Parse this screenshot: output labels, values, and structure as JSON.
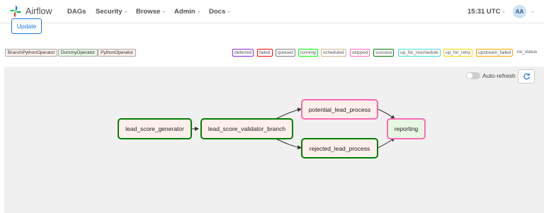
{
  "nav": {
    "brand": "Airflow",
    "items": [
      "DAGs",
      "Security",
      "Browse",
      "Admin",
      "Docs"
    ],
    "time": "15:31 UTC",
    "user_initials": "AA"
  },
  "update_label": "Update",
  "operators": [
    {
      "label": "BranchPythonOperator",
      "color": "#ffefeb"
    },
    {
      "label": "DummyOperator",
      "color": "#e8f7e4"
    },
    {
      "label": "PythonOperator",
      "color": "#ffefeb"
    }
  ],
  "statuses": [
    {
      "label": "deferred",
      "color": "#8a2be2"
    },
    {
      "label": "failed",
      "color": "#ff0000"
    },
    {
      "label": "queued",
      "color": "#808080"
    },
    {
      "label": "running",
      "color": "#00ff00"
    },
    {
      "label": "scheduled",
      "color": "#d2b48c"
    },
    {
      "label": "skipped",
      "color": "#ff69b4"
    },
    {
      "label": "success",
      "color": "#008000"
    },
    {
      "label": "up_for_reschedule",
      "color": "#40e0d0"
    },
    {
      "label": "up_for_retry",
      "color": "#ffd700"
    },
    {
      "label": "upstream_failed",
      "color": "#ffa500"
    },
    {
      "label": "no_status",
      "color": "#ffffff"
    }
  ],
  "graph": {
    "auto_refresh_label": "Auto-refresh",
    "nodes": {
      "lead_score_generator": "lead_score_generator",
      "lead_score_validator_branch": "lead_score_validator_branch",
      "potential_lead_process": "potential_lead_process",
      "rejected_lead_process": "rejected_lead_process",
      "reporting": "reporting"
    }
  },
  "colors": {
    "success_border": "#008000",
    "skipped_border": "#ff69b4",
    "python_fill": "#ffefeb",
    "dummy_fill": "#e8f7e4"
  }
}
